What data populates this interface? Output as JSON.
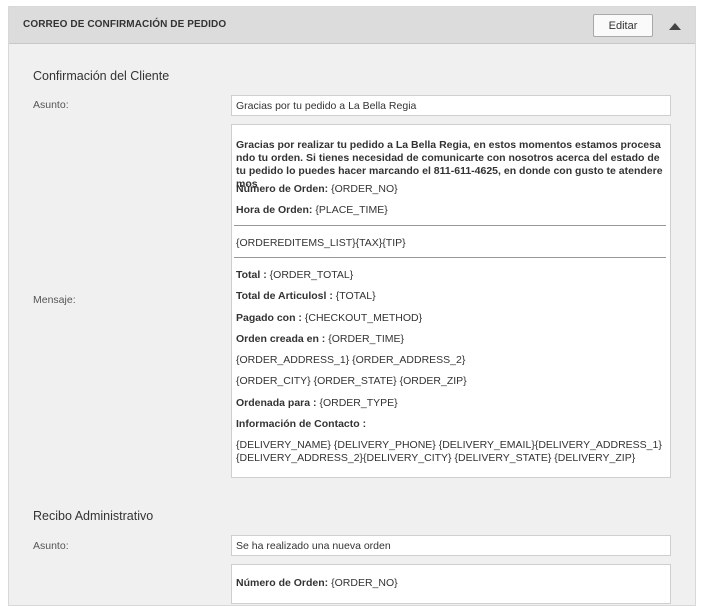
{
  "header": {
    "title": "CORREO DE CONFIRMACIÓN DE PEDIDO",
    "edit_label": "Editar"
  },
  "customer_confirmation": {
    "section_title": "Confirmación del Cliente",
    "subject_label": "Asunto:",
    "subject_value": "Gracias por tu pedido a La Bella Regia",
    "message_label": "Mensaje:",
    "message": {
      "intro": "Gracias por realizar tu pedido a La Bella Regia, en estos momentos estamos procesando tu orden. Si tienes necesidad de comunicarte con nosotros acerca del estado de tu pedido lo puedes hacer marcando el 811-611-4625, en donde con gusto te atenderemos",
      "order_no_label": "Número de Orden:",
      "order_no_value": "{ORDER_NO}",
      "order_time_label": "Hora de Orden:",
      "order_time_value": "{PLACE_TIME}",
      "items_line": "{ORDEREDITEMS_LIST}{TAX}{TIP}",
      "total_label": "Total :",
      "total_value": "{ORDER_TOTAL}",
      "articles_label": "Total de Articulosl :",
      "articles_value": "{TOTAL}",
      "paid_label": "Pagado con :",
      "paid_value": "{CHECKOUT_METHOD}",
      "created_label": "Orden creada en :",
      "created_value": "{ORDER_TIME}",
      "address_line": "{ORDER_ADDRESS_1} {ORDER_ADDRESS_2}",
      "city_line": "{ORDER_CITY} {ORDER_STATE} {ORDER_ZIP}",
      "ordered_for_label": "Ordenada para :",
      "ordered_for_value": "{ORDER_TYPE}",
      "contact_label": "Información de Contacto :",
      "contact_value": "{DELIVERY_NAME} {DELIVERY_PHONE} {DELIVERY_EMAIL}{DELIVERY_ADDRESS_1} {DELIVERY_ADDRESS_2}{DELIVERY_CITY} {DELIVERY_STATE} {DELIVERY_ZIP}"
    }
  },
  "admin_receipt": {
    "section_title": "Recibo Administrativo",
    "subject_label": "Asunto:",
    "subject_value": "Se ha realizado una nueva orden",
    "message": {
      "order_no_label": "Número de Orden:",
      "order_no_value": "{ORDER_NO}"
    }
  }
}
